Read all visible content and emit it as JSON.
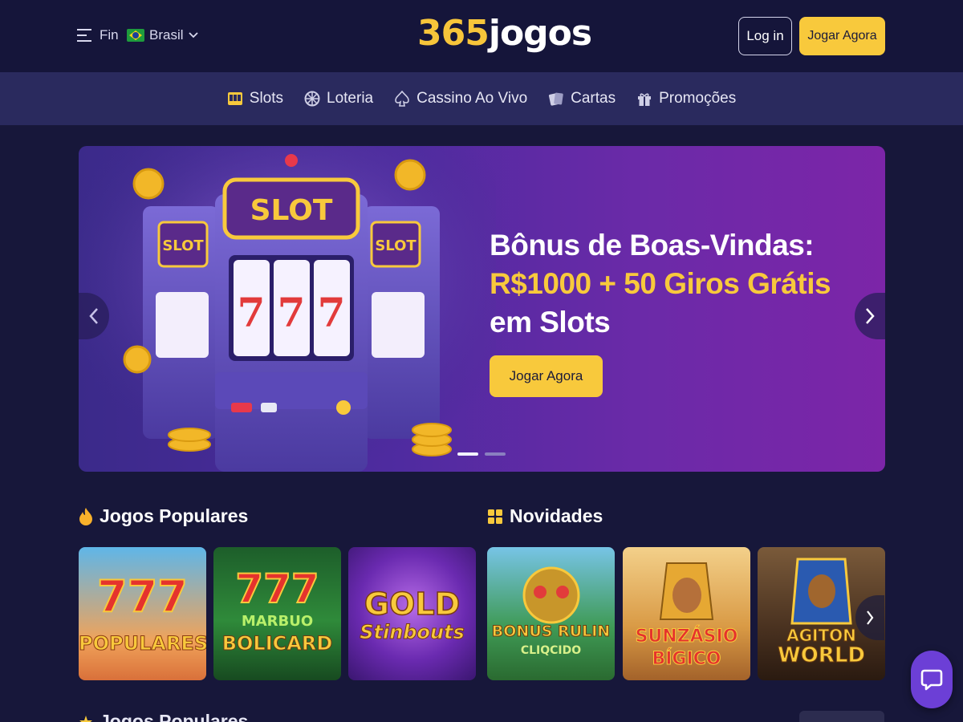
{
  "header": {
    "menu_label": "Fin",
    "language": "Brasil",
    "logo_number": "365",
    "logo_text": "jogos",
    "login_label": "Log in",
    "play_label": "Jogar Agora"
  },
  "nav": {
    "items": [
      {
        "label": "Slots",
        "icon": "slot-machine-icon"
      },
      {
        "label": "Loteria",
        "icon": "lottery-ball-icon"
      },
      {
        "label": "Cassino Ao Vivo",
        "icon": "spade-icon"
      },
      {
        "label": "Cartas",
        "icon": "cards-icon"
      },
      {
        "label": "Promoções",
        "icon": "gift-icon"
      }
    ]
  },
  "hero": {
    "line1": "Bônus de Boas-Vindas:",
    "line2": "R$1000 + 50 Giros Grátis",
    "line3": "em Slots",
    "cta_label": "Jogar Agora",
    "art_main_label": "SLOT",
    "art_side_label": "SLOT",
    "reel_symbol": "7",
    "slide_count": 2,
    "active_slide": 1
  },
  "sections": {
    "popular_title": "Jogos Populares",
    "new_title": "Novidades",
    "bottom_title": "Jogos Populares"
  },
  "games": {
    "popular": [
      {
        "line1": "777",
        "line2": "POPULARES"
      },
      {
        "line1": "777",
        "line2": "MARBUO",
        "line3": "BOLICARD"
      },
      {
        "line1": "GOLD",
        "line2": "Stinbouts"
      }
    ],
    "new": [
      {
        "line1": "BONUS RULIN",
        "line2": "CLIQCIDO"
      },
      {
        "line1": "SUNZÁSIO",
        "line2": "BÍGICO"
      },
      {
        "line1": "AGITON",
        "line2": "WORLD"
      }
    ]
  },
  "colors": {
    "accent": "#f8c93c",
    "background": "#17173a",
    "nav": "#2a2a5e",
    "chat": "#6c3fd6"
  }
}
